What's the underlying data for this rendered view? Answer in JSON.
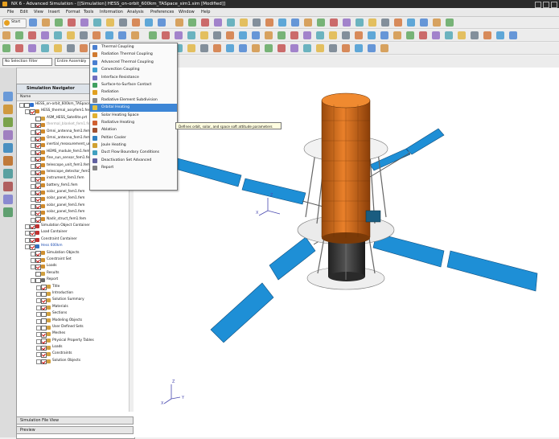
{
  "window": {
    "title": "NX 6 - Advanced Simulation - [[Simulation] HESS_on-orbit_600km_TASpace_sim1.sim [Modified]]"
  },
  "menubar": {
    "items": [
      "File",
      "Edit",
      "View",
      "Insert",
      "Format",
      "Tools",
      "Information",
      "Analysis",
      "Preferences",
      "Window",
      "Help"
    ]
  },
  "toolbar": {
    "start_label": "Start",
    "selection_filter": "No Selection Filter",
    "assembly_scope": "Entire Assembly"
  },
  "navigator": {
    "title": "Simulation Navigator",
    "column_name": "Name",
    "rows": [
      {
        "label": "HESS_on-orbit_600km_TASpace_sim1",
        "indent": 0,
        "icon": "#2d6fcf",
        "check": false,
        "exp": true
      },
      {
        "label": "HESS_thermal_assyfem1.fem",
        "indent": 1,
        "icon": "#d08a2c",
        "check": true,
        "exp": true
      },
      {
        "label": "ASM_HESS_Satellite.prt",
        "indent": 2,
        "icon": "#d0a040",
        "check": false,
        "exp": false
      },
      {
        "label": "thermal_blanket_fem1.fem",
        "indent": 2,
        "icon": "#d08a2c",
        "check": true,
        "exp": true,
        "dim": true
      },
      {
        "label": "Omni_antenna_fem1.fem",
        "indent": 2,
        "icon": "#d08a2c",
        "check": true,
        "exp": true
      },
      {
        "label": "Omni_antenna_fem1.fem",
        "indent": 2,
        "icon": "#d08a2c",
        "check": true,
        "exp": true
      },
      {
        "label": "inertial_measurement_unit.fem",
        "indent": 2,
        "icon": "#d08a2c",
        "check": true,
        "exp": true
      },
      {
        "label": "HEMS_module_fem1.fem",
        "indent": 2,
        "icon": "#d08a2c",
        "check": true,
        "exp": true
      },
      {
        "label": "fine_sun_sensor_fem1.fem",
        "indent": 2,
        "icon": "#d08a2c",
        "check": true,
        "exp": true
      },
      {
        "label": "telescope_unit_fem1.fem",
        "indent": 2,
        "icon": "#d08a2c",
        "check": true,
        "exp": true
      },
      {
        "label": "telescope_detector_fem1.fem",
        "indent": 2,
        "icon": "#d08a2c",
        "check": true,
        "exp": true
      },
      {
        "label": "instrument_fem1.fem",
        "indent": 2,
        "icon": "#d08a2c",
        "check": true,
        "exp": true
      },
      {
        "label": "battery_fem1.fem",
        "indent": 2,
        "icon": "#d08a2c",
        "check": true,
        "exp": true
      },
      {
        "label": "solar_panel_fem1.fem",
        "indent": 2,
        "icon": "#d08a2c",
        "check": true,
        "exp": true
      },
      {
        "label": "solar_panel_fem1.fem",
        "indent": 2,
        "icon": "#d08a2c",
        "check": true,
        "exp": true
      },
      {
        "label": "solar_panel_fem1.fem",
        "indent": 2,
        "icon": "#d08a2c",
        "check": true,
        "exp": true
      },
      {
        "label": "solar_panel_fem1.fem",
        "indent": 2,
        "icon": "#d08a2c",
        "check": true,
        "exp": true
      },
      {
        "label": "Nadir_struct_fem1.fem",
        "indent": 2,
        "icon": "#d08a2c",
        "check": true,
        "exp": true
      },
      {
        "label": "Simulation Object Container",
        "indent": 1,
        "icon": "#c03030",
        "check": true,
        "exp": true
      },
      {
        "label": "Load Container",
        "indent": 1,
        "icon": "#c03030",
        "check": true,
        "exp": true
      },
      {
        "label": "Constraint Container",
        "indent": 1,
        "icon": "#c03030",
        "check": true,
        "exp": true
      },
      {
        "label": "Hess 600km",
        "indent": 1,
        "icon": "#3070c0",
        "check": true,
        "exp": true,
        "blue": true
      },
      {
        "label": "Simulation Objects",
        "indent": 2,
        "icon": "#d09030",
        "check": true,
        "exp": true
      },
      {
        "label": "Constraint Set",
        "indent": 2,
        "icon": "#d09030",
        "check": true,
        "exp": true
      },
      {
        "label": "Loads",
        "indent": 2,
        "icon": "#d09030",
        "check": true,
        "exp": true
      },
      {
        "label": "Results",
        "indent": 2,
        "icon": "#d0a040",
        "check": false,
        "exp": false
      },
      {
        "label": "Report",
        "indent": 2,
        "icon": "#6a6a6a",
        "check": false,
        "exp": true
      },
      {
        "label": "Title",
        "indent": 3,
        "icon": "#d0a040",
        "check": true,
        "exp": true
      },
      {
        "label": "Introduction",
        "indent": 3,
        "icon": "#d0a040",
        "check": false,
        "exp": true
      },
      {
        "label": "Solution Summary",
        "indent": 3,
        "icon": "#d0a040",
        "check": true,
        "exp": true
      },
      {
        "label": "Materials",
        "indent": 3,
        "icon": "#d0a040",
        "check": true,
        "exp": true
      },
      {
        "label": "Sections",
        "indent": 3,
        "icon": "#d0a040",
        "check": false,
        "exp": true
      },
      {
        "label": "Modeling Objects",
        "indent": 3,
        "icon": "#d0a040",
        "check": false,
        "exp": true
      },
      {
        "label": "User Defined Sets",
        "indent": 3,
        "icon": "#d0a040",
        "check": false,
        "exp": true
      },
      {
        "label": "Meshes",
        "indent": 3,
        "icon": "#d0a040",
        "check": true,
        "exp": true
      },
      {
        "label": "Physical Property Tables",
        "indent": 3,
        "icon": "#d0a040",
        "check": true,
        "exp": true
      },
      {
        "label": "Loads",
        "indent": 3,
        "icon": "#d0a040",
        "check": true,
        "exp": true
      },
      {
        "label": "Constraints",
        "indent": 3,
        "icon": "#d0a040",
        "check": true,
        "exp": true
      },
      {
        "label": "Solution Objects",
        "indent": 3,
        "icon": "#d0a040",
        "check": true,
        "exp": true
      }
    ],
    "footer_file_view": "Simulation File View",
    "footer_preview": "Preview"
  },
  "dropdown": {
    "items": [
      {
        "label": "Thermal Coupling",
        "icon": "#4a7fd0"
      },
      {
        "label": "Radiation Thermal Coupling",
        "icon": "#d07a30"
      },
      {
        "label": "Advanced Thermal Coupling",
        "icon": "#4a7fd0"
      },
      {
        "label": "Convection Coupling",
        "icon": "#40a0d0"
      },
      {
        "label": "Interface Resistance",
        "icon": "#7070c0"
      },
      {
        "label": "Surface-to-Surface Contact",
        "icon": "#40a060"
      },
      {
        "label": "Radiation",
        "icon": "#e0a020"
      },
      {
        "label": "Radiative Element Subdivision",
        "icon": "#888888"
      },
      {
        "label": "Orbital Heating",
        "icon": "#e0c040"
      },
      {
        "label": "Solar Heating Space",
        "icon": "#e0b030"
      },
      {
        "label": "Radiative Heating",
        "icon": "#d06030"
      },
      {
        "label": "Ablation",
        "icon": "#a05030"
      },
      {
        "label": "Peltier Cooler",
        "icon": "#3080c0"
      },
      {
        "label": "Joule Heating",
        "icon": "#d0a030"
      },
      {
        "label": "Duct Flow Boundary Conditions",
        "icon": "#40a0c0"
      },
      {
        "label": "Deactivation Set Advanced",
        "icon": "#6060a0"
      },
      {
        "label": "Report",
        "icon": "#808080"
      }
    ],
    "highlighted_index": 8,
    "tooltip": "Defines orbit, solar, and space soft attitude parameters"
  },
  "viewport": {
    "triad_labels": {
      "x": "X",
      "y": "Y",
      "z": "Z"
    }
  },
  "colors": {
    "panel_blue": "#1e8fd6",
    "body_orange": "#e2731c",
    "selection_blue": "#3d86d6"
  }
}
